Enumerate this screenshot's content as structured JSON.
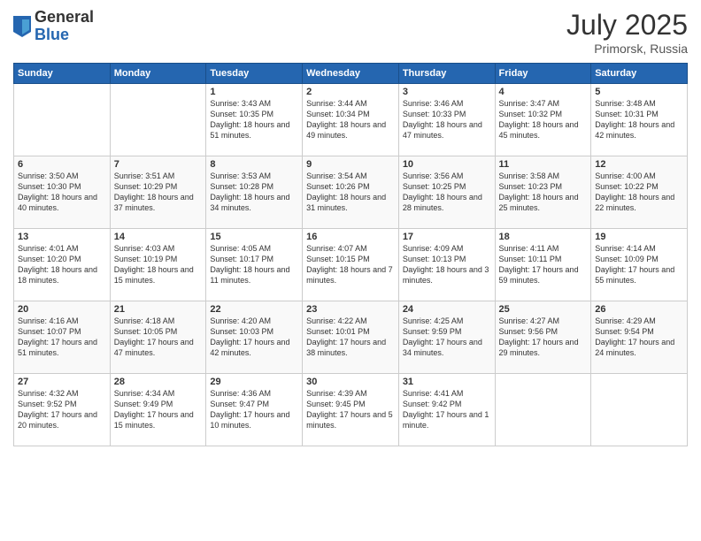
{
  "header": {
    "logo_general": "General",
    "logo_blue": "Blue",
    "title_month": "July 2025",
    "title_location": "Primorsk, Russia"
  },
  "weekdays": [
    "Sunday",
    "Monday",
    "Tuesday",
    "Wednesday",
    "Thursday",
    "Friday",
    "Saturday"
  ],
  "weeks": [
    [
      {
        "day": "",
        "text": ""
      },
      {
        "day": "",
        "text": ""
      },
      {
        "day": "1",
        "text": "Sunrise: 3:43 AM\nSunset: 10:35 PM\nDaylight: 18 hours and 51 minutes."
      },
      {
        "day": "2",
        "text": "Sunrise: 3:44 AM\nSunset: 10:34 PM\nDaylight: 18 hours and 49 minutes."
      },
      {
        "day": "3",
        "text": "Sunrise: 3:46 AM\nSunset: 10:33 PM\nDaylight: 18 hours and 47 minutes."
      },
      {
        "day": "4",
        "text": "Sunrise: 3:47 AM\nSunset: 10:32 PM\nDaylight: 18 hours and 45 minutes."
      },
      {
        "day": "5",
        "text": "Sunrise: 3:48 AM\nSunset: 10:31 PM\nDaylight: 18 hours and 42 minutes."
      }
    ],
    [
      {
        "day": "6",
        "text": "Sunrise: 3:50 AM\nSunset: 10:30 PM\nDaylight: 18 hours and 40 minutes."
      },
      {
        "day": "7",
        "text": "Sunrise: 3:51 AM\nSunset: 10:29 PM\nDaylight: 18 hours and 37 minutes."
      },
      {
        "day": "8",
        "text": "Sunrise: 3:53 AM\nSunset: 10:28 PM\nDaylight: 18 hours and 34 minutes."
      },
      {
        "day": "9",
        "text": "Sunrise: 3:54 AM\nSunset: 10:26 PM\nDaylight: 18 hours and 31 minutes."
      },
      {
        "day": "10",
        "text": "Sunrise: 3:56 AM\nSunset: 10:25 PM\nDaylight: 18 hours and 28 minutes."
      },
      {
        "day": "11",
        "text": "Sunrise: 3:58 AM\nSunset: 10:23 PM\nDaylight: 18 hours and 25 minutes."
      },
      {
        "day": "12",
        "text": "Sunrise: 4:00 AM\nSunset: 10:22 PM\nDaylight: 18 hours and 22 minutes."
      }
    ],
    [
      {
        "day": "13",
        "text": "Sunrise: 4:01 AM\nSunset: 10:20 PM\nDaylight: 18 hours and 18 minutes."
      },
      {
        "day": "14",
        "text": "Sunrise: 4:03 AM\nSunset: 10:19 PM\nDaylight: 18 hours and 15 minutes."
      },
      {
        "day": "15",
        "text": "Sunrise: 4:05 AM\nSunset: 10:17 PM\nDaylight: 18 hours and 11 minutes."
      },
      {
        "day": "16",
        "text": "Sunrise: 4:07 AM\nSunset: 10:15 PM\nDaylight: 18 hours and 7 minutes."
      },
      {
        "day": "17",
        "text": "Sunrise: 4:09 AM\nSunset: 10:13 PM\nDaylight: 18 hours and 3 minutes."
      },
      {
        "day": "18",
        "text": "Sunrise: 4:11 AM\nSunset: 10:11 PM\nDaylight: 17 hours and 59 minutes."
      },
      {
        "day": "19",
        "text": "Sunrise: 4:14 AM\nSunset: 10:09 PM\nDaylight: 17 hours and 55 minutes."
      }
    ],
    [
      {
        "day": "20",
        "text": "Sunrise: 4:16 AM\nSunset: 10:07 PM\nDaylight: 17 hours and 51 minutes."
      },
      {
        "day": "21",
        "text": "Sunrise: 4:18 AM\nSunset: 10:05 PM\nDaylight: 17 hours and 47 minutes."
      },
      {
        "day": "22",
        "text": "Sunrise: 4:20 AM\nSunset: 10:03 PM\nDaylight: 17 hours and 42 minutes."
      },
      {
        "day": "23",
        "text": "Sunrise: 4:22 AM\nSunset: 10:01 PM\nDaylight: 17 hours and 38 minutes."
      },
      {
        "day": "24",
        "text": "Sunrise: 4:25 AM\nSunset: 9:59 PM\nDaylight: 17 hours and 34 minutes."
      },
      {
        "day": "25",
        "text": "Sunrise: 4:27 AM\nSunset: 9:56 PM\nDaylight: 17 hours and 29 minutes."
      },
      {
        "day": "26",
        "text": "Sunrise: 4:29 AM\nSunset: 9:54 PM\nDaylight: 17 hours and 24 minutes."
      }
    ],
    [
      {
        "day": "27",
        "text": "Sunrise: 4:32 AM\nSunset: 9:52 PM\nDaylight: 17 hours and 20 minutes."
      },
      {
        "day": "28",
        "text": "Sunrise: 4:34 AM\nSunset: 9:49 PM\nDaylight: 17 hours and 15 minutes."
      },
      {
        "day": "29",
        "text": "Sunrise: 4:36 AM\nSunset: 9:47 PM\nDaylight: 17 hours and 10 minutes."
      },
      {
        "day": "30",
        "text": "Sunrise: 4:39 AM\nSunset: 9:45 PM\nDaylight: 17 hours and 5 minutes."
      },
      {
        "day": "31",
        "text": "Sunrise: 4:41 AM\nSunset: 9:42 PM\nDaylight: 17 hours and 1 minute."
      },
      {
        "day": "",
        "text": ""
      },
      {
        "day": "",
        "text": ""
      }
    ]
  ]
}
